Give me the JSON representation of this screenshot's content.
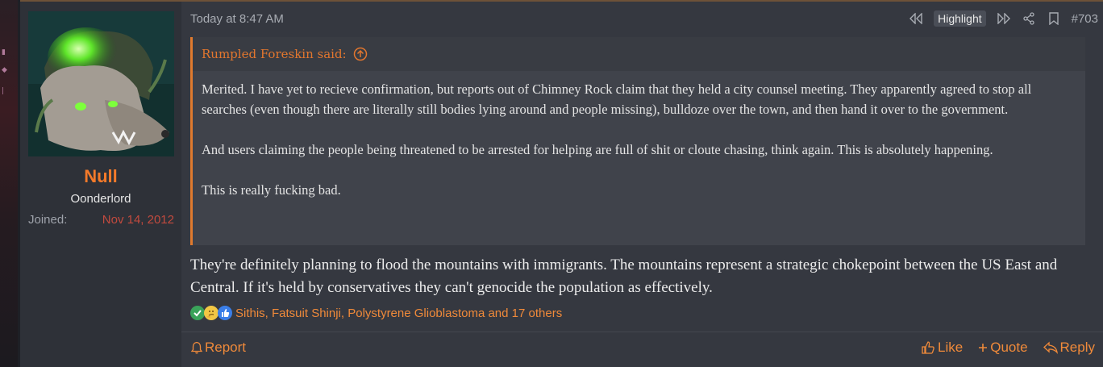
{
  "user": {
    "name": "Null",
    "title": "Oonderlord",
    "joined_label": "Joined:",
    "joined_date": "Nov 14, 2012"
  },
  "post": {
    "timestamp": "Today at 8:47 AM",
    "highlight_label": "Highlight",
    "post_number": "#703",
    "quote": {
      "author_line": "Rumpled Foreskin said:",
      "paragraphs": [
        "Merited. I have yet to recieve confirmation, but reports out of Chimney Rock claim that they held a city counsel meeting. They apparently agreed to stop all searches (even though there are literally still bodies lying around and people missing), bulldoze over the town, and then hand it over to the government.",
        "And users claiming the people being threatened to be arrested for helping are full of shit or cloute chasing, think again. This is absolutely happening.",
        "This is really fucking bad."
      ]
    },
    "body": "They're definitely planning to flood the mountains with immigrants. The mountains represent a strategic chokepoint between the US East and Central. If it's held by conservatives they can't genocide the population as effectively.",
    "reactions_text": "Sithis, Fatsuit Shinji, Polystyrene Glioblastoma and 17 others",
    "reaction_icons": [
      "checkmark-icon",
      "thinking-icon",
      "thumbs-up-icon"
    ]
  },
  "footer": {
    "report_label": "Report",
    "like_label": "Like",
    "quote_label": "Quote",
    "reply_label": "Reply"
  },
  "colors": {
    "accent": "#f08a3a",
    "username": "#f47a2a",
    "joined_date": "#c24a3e",
    "post_bg": "#353840",
    "quote_border": "#e07a2e"
  }
}
